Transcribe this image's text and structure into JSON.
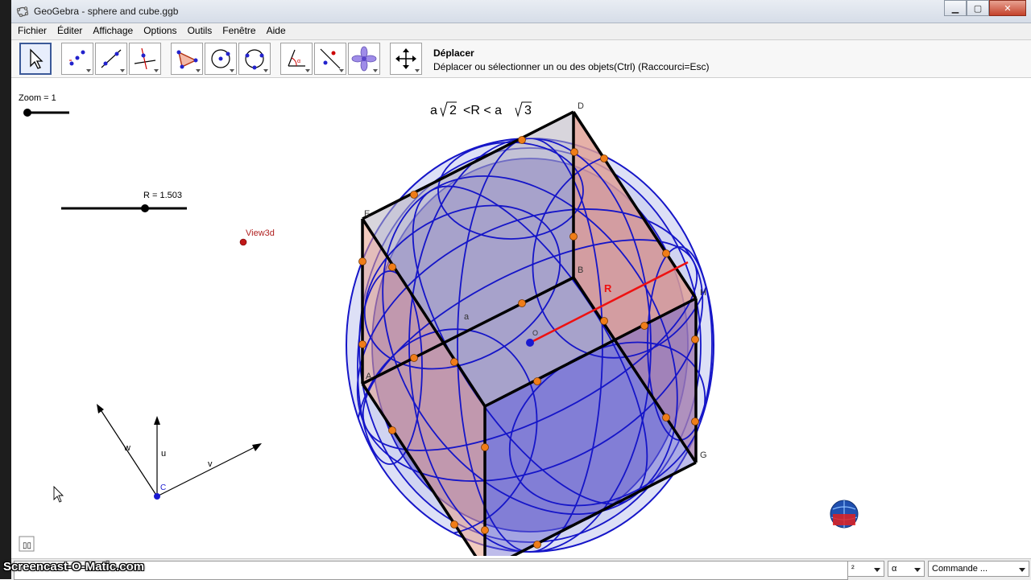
{
  "window": {
    "title": "GeoGebra - sphere and cube.ggb"
  },
  "menu": [
    "Fichier",
    "Éditer",
    "Affichage",
    "Options",
    "Outils",
    "Fenêtre",
    "Aide"
  ],
  "toolbar": {
    "tools": [
      "move-tool-icon",
      "point-tool-icon",
      "line-tool-icon",
      "perpendicular-line-tool-icon",
      "polygon-tool-icon",
      "circle-center-point-tool-icon",
      "circle-three-points-tool-icon",
      "angle-tool-icon",
      "reflect-tool-icon",
      "slider-tool-icon",
      "move-graphics-view-tool-icon"
    ],
    "active_tool_title": "Déplacer",
    "active_tool_desc": "Déplacer ou sélectionner un ou des objets(Ctrl) (Raccourci=Esc)"
  },
  "graphics": {
    "zoom_label": "Zoom = 1",
    "r_label": "R = 1.503",
    "view3d_label": "View3d",
    "formula_a": "a",
    "formula_mid": "<R < a",
    "formula_sqrt2": "2",
    "formula_sqrt3": "3",
    "vector_w": "w",
    "vector_u": "u",
    "vector_v": "v",
    "point_c": "C",
    "vertex_labels": {
      "D": "D",
      "E": "E",
      "B": "B",
      "H": "H",
      "A": "A",
      "G": "G",
      "O": "O"
    },
    "edge_label_a": "a",
    "radius_label": "R"
  },
  "input_bar": {
    "command_value": "",
    "dropdown1": "²",
    "dropdown2": "α",
    "dropdown3": "Commande ..."
  },
  "watermark": "Screencast-O-Matic.com",
  "colors": {
    "sphere_stroke": "#1515c8",
    "sphere_fill": "#4b4bc4",
    "cube_face": "#e8a08a",
    "cube_edge": "#000000",
    "orange_point": "#f07d18",
    "radius_line": "#ee1111"
  }
}
